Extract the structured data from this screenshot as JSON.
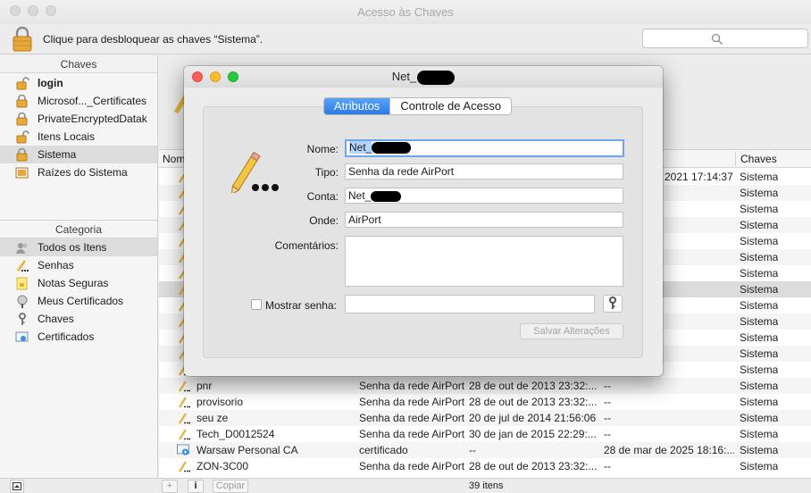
{
  "window": {
    "title": "Acesso às Chaves"
  },
  "lockbar": {
    "text": "Clique para desbloquear as chaves “Sistema”.",
    "search_placeholder": ""
  },
  "sidebar": {
    "keychains_header": "Chaves",
    "keychains": [
      {
        "label": "login",
        "icon": "lock-open-icon",
        "bold": true
      },
      {
        "label": "Microsof..._Certificates",
        "icon": "lock-icon"
      },
      {
        "label": "PrivateEncryptedDatak",
        "icon": "lock-icon"
      },
      {
        "label": "Itens Locais",
        "icon": "lock-open-icon"
      },
      {
        "label": "Sistema",
        "icon": "lock-icon",
        "selected": true
      },
      {
        "label": "Raízes do Sistema",
        "icon": "folder-icon"
      }
    ],
    "category_header": "Categoria",
    "categories": [
      {
        "label": "Todos os Itens",
        "icon": "people-icon",
        "selected": true
      },
      {
        "label": "Senhas",
        "icon": "pencil-icon"
      },
      {
        "label": "Notas Seguras",
        "icon": "note-icon"
      },
      {
        "label": "Meus Certificados",
        "icon": "certificate-icon"
      },
      {
        "label": "Chaves",
        "icon": "key-icon"
      },
      {
        "label": "Certificados",
        "icon": "certificate-icon"
      }
    ]
  },
  "table": {
    "headers": {
      "name": "Nome",
      "keychain": "Chaves"
    },
    "partial_rows": [
      {
        "date": "2021 17:14:37",
        "keychain": "Sistema"
      },
      {
        "keychain": "Sistema"
      },
      {
        "keychain": "Sistema"
      },
      {
        "keychain": "Sistema"
      },
      {
        "keychain": "Sistema"
      },
      {
        "keychain": "Sistema"
      },
      {
        "keychain": "Sistema"
      },
      {
        "keychain": "Sistema"
      },
      {
        "keychain": "Sistema"
      },
      {
        "keychain": "Sistema"
      },
      {
        "keychain": "Sistema"
      },
      {
        "keychain": "Sistema"
      },
      {
        "keychain": "Sistema"
      }
    ],
    "rows": [
      {
        "name": "pnr",
        "kind": "Senha da rede AirPort",
        "modified": "28 de out de 2013 23:32:...",
        "expires": "--",
        "keychain": "Sistema",
        "icon": "pencil-icon"
      },
      {
        "name": "provisorio",
        "kind": "Senha da rede AirPort",
        "modified": "28 de out de 2013 23:32:...",
        "expires": "--",
        "keychain": "Sistema",
        "icon": "pencil-icon"
      },
      {
        "name": "seu ze",
        "kind": "Senha da rede AirPort",
        "modified": "20 de jul de 2014 21:56:06",
        "expires": "--",
        "keychain": "Sistema",
        "icon": "pencil-icon"
      },
      {
        "name": "Tech_D0012524",
        "kind": "Senha da rede AirPort",
        "modified": "30 de jan de 2015 22:29:...",
        "expires": "--",
        "keychain": "Sistema",
        "icon": "pencil-icon"
      },
      {
        "name": "Warsaw Personal CA",
        "kind": "certificado",
        "modified": "--",
        "expires": "28 de mar de 2025 18:16:...",
        "keychain": "Sistema",
        "icon": "certificate-icon"
      },
      {
        "name": "ZON-3C00",
        "kind": "Senha da rede AirPort",
        "modified": "28 de out de 2013 23:32:...",
        "expires": "--",
        "keychain": "Sistema",
        "icon": "pencil-icon"
      }
    ]
  },
  "statusbar": {
    "add": "+",
    "info": "i",
    "copy": "Copiar",
    "count": "39 itens"
  },
  "dialog": {
    "title": "Net_",
    "tabs": [
      {
        "label": "Atributos",
        "active": true
      },
      {
        "label": "Controle de Acesso",
        "active": false
      }
    ],
    "fields": {
      "nome_label": "Nome:",
      "nome_value": "Net_",
      "tipo_label": "Tipo:",
      "tipo_value": "Senha da rede AirPort",
      "conta_label": "Conta:",
      "conta_value": "Net_",
      "onde_label": "Onde:",
      "onde_value": "AirPort",
      "comentarios_label": "Comentários:",
      "comentarios_value": "",
      "mostrar_label": "Mostrar senha:",
      "mostrar_value": ""
    },
    "save_label": "Salvar Alterações"
  }
}
